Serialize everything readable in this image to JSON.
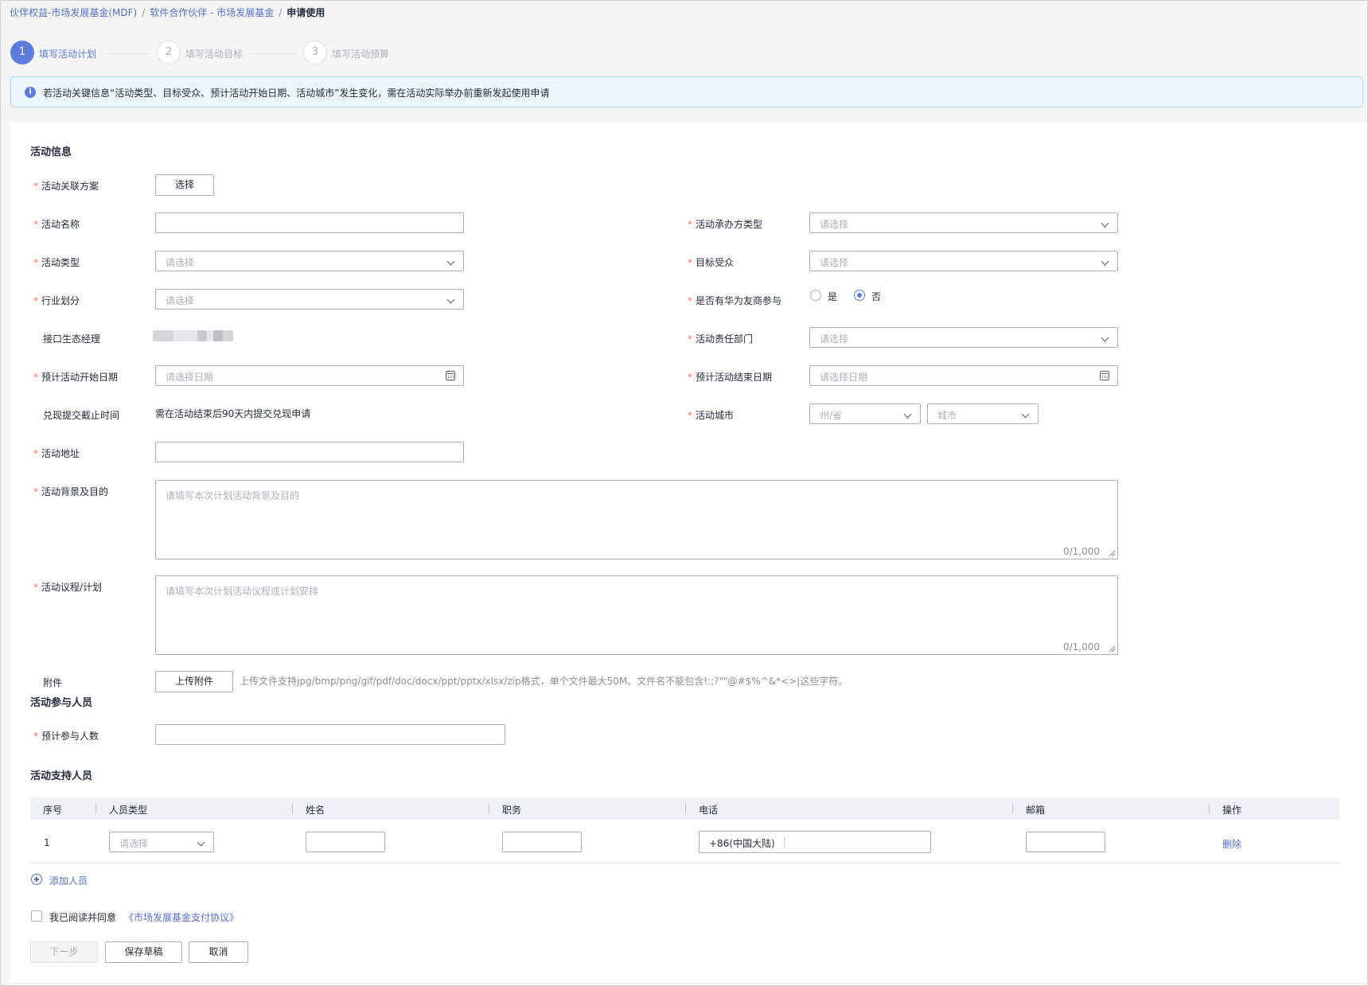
{
  "breadcrumb": {
    "item1": "伙伴权益-市场发展基金(MDF)",
    "item2": "软件合作伙伴 - 市场发展基金",
    "current": "申请使用",
    "separator": "/"
  },
  "steps": [
    {
      "number": "1",
      "label": "填写活动计划",
      "active": true
    },
    {
      "number": "2",
      "label": "填写活动目标",
      "active": false
    },
    {
      "number": "3",
      "label": "填写活动预算",
      "active": false
    }
  ],
  "notice": {
    "icon": "info-icon",
    "icon_glyph": "i",
    "text": "若活动关键信息“活动类型、目标受众、预计活动开始日期、活动城市”发生变化，需在活动实际举办前重新发起使用申请"
  },
  "sections": {
    "activity_info": "活动信息",
    "participants": "活动参与人员",
    "support_staff": "活动支持人员"
  },
  "form": {
    "scheme": {
      "label": "活动关联方案",
      "button": "选择"
    },
    "name": {
      "label": "活动名称",
      "value": ""
    },
    "organizer_type": {
      "label": "活动承办方类型",
      "placeholder": "请选择"
    },
    "activity_type": {
      "label": "活动类型",
      "placeholder": "请选择"
    },
    "target_audience": {
      "label": "目标受众",
      "placeholder": "请选择"
    },
    "industry": {
      "label": "行业划分",
      "placeholder": "请选择"
    },
    "huawei_partner": {
      "label": "是否有华为友商参与",
      "option_yes": "是",
      "option_no": "否",
      "selected": "否"
    },
    "eco_manager": {
      "label": "接口生态经理"
    },
    "responsible_dept": {
      "label": "活动责任部门",
      "placeholder": "请选择"
    },
    "start_date": {
      "label": "预计活动开始日期",
      "placeholder": "请选择日期"
    },
    "end_date": {
      "label": "预计活动结束日期",
      "placeholder": "请选择日期"
    },
    "deadline": {
      "label": "兑现提交截止时间",
      "value": "需在活动结束后90天内提交兑现申请"
    },
    "city": {
      "label": "活动城市",
      "province_placeholder": "州/省",
      "city_placeholder": "城市"
    },
    "address": {
      "label": "活动地址",
      "value": ""
    },
    "background": {
      "label": "活动背景及目的",
      "placeholder": "请填写本次计划活动背景及目的",
      "counter": "0/1,000"
    },
    "agenda": {
      "label": "活动议程/计划",
      "placeholder": "请填写本次计划活动议程或计划安排",
      "counter": "0/1,000"
    },
    "attachment": {
      "label": "附件",
      "button": "上传附件",
      "hint": "上传文件支持jpg/bmp/png/gif/pdf/doc/docx/ppt/pptx/xlsx/zip格式，单个文件最大50M。文件名不能包含!:;?\"\"@#$%^&*<>|这些字符。"
    },
    "expected_count": {
      "label": "预计参与人数",
      "value": ""
    }
  },
  "table": {
    "headers": [
      "序号",
      "人员类型",
      "姓名",
      "职务",
      "电话",
      "邮箱",
      "操作"
    ],
    "rows": [
      {
        "index": "1",
        "type_placeholder": "请选择",
        "name": "",
        "title": "",
        "phone_prefix": "+86(中国大陆)",
        "email": "",
        "action": "删除"
      }
    ],
    "add_label": "添加人员"
  },
  "agreement": {
    "text": "我已阅读并同意",
    "link": "《市场发展基金支付协议》",
    "checked": false
  },
  "footer": {
    "next": "下一步",
    "save": "保存草稿",
    "cancel": "取消"
  },
  "colors": {
    "accent": "#5e7ce0",
    "link": "#526ecc",
    "required": "#f66f6a",
    "notice_bg": "#ebf6ff"
  }
}
